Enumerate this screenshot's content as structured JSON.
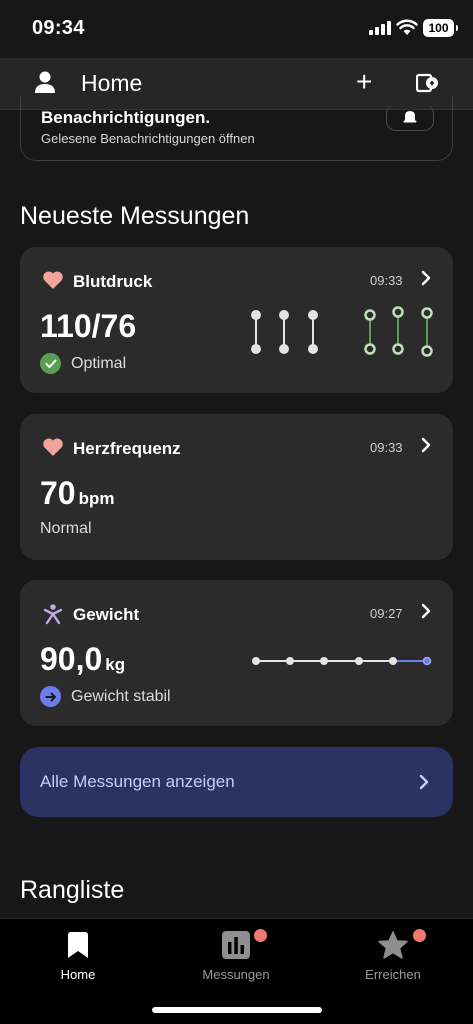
{
  "status_bar": {
    "time": "09:34",
    "battery": "100"
  },
  "header": {
    "title": "Home"
  },
  "notice": {
    "title": "Benachrichtigungen.",
    "subtitle": "Gelesene Benachrichtigungen öffnen"
  },
  "latest": {
    "title": "Neueste Messungen",
    "cards": [
      {
        "title": "Blutdruck",
        "time": "09:33",
        "value": "110/76",
        "unit": "",
        "status": "Optimal",
        "status_color": "#5a9e55",
        "icon": "heart-icon"
      },
      {
        "title": "Herzfrequenz",
        "time": "09:33",
        "value": "70",
        "unit": "bpm",
        "status": "Normal",
        "icon": "heart-icon"
      },
      {
        "title": "Gewicht",
        "time": "09:27",
        "value": "90,0",
        "unit": "kg",
        "status": "Gewicht stabil",
        "status_color": "#6c7ce8",
        "icon": "person-icon"
      }
    ]
  },
  "all_measurements": {
    "label": "Alle Messungen anzeigen"
  },
  "ranking": {
    "title": "Rangliste"
  },
  "tabs": [
    {
      "label": "Home",
      "icon": "bookmark-icon",
      "active": true
    },
    {
      "label": "Messungen",
      "icon": "bar-chart-icon",
      "badge": true
    },
    {
      "label": "Erreichen",
      "icon": "star-icon",
      "badge": true
    }
  ],
  "colors": {
    "heart": "#f2a49a",
    "accent_green": "#5a9e55",
    "accent_blue": "#6c7ce8",
    "button_bg": "#2a3362",
    "badge": "#ef7a6f"
  }
}
